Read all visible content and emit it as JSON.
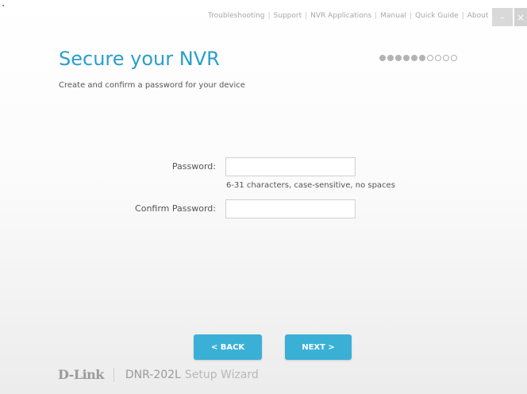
{
  "header": {
    "links": [
      "Troubleshooting",
      "Support",
      "NVR Applications",
      "Manual",
      "Quick Guide",
      "About"
    ],
    "minimize_label": "–",
    "close_label": "×"
  },
  "page": {
    "title": "Secure your NVR",
    "subtitle": "Create and confirm a password for your device"
  },
  "progress": {
    "total_steps": 10,
    "completed_steps": 6
  },
  "form": {
    "password_label": "Password:",
    "password_value": "",
    "password_hint": "6-31 characters, case-sensitive, no spaces",
    "confirm_label": "Confirm Password:",
    "confirm_value": ""
  },
  "buttons": {
    "back_label": "< BACK",
    "next_label": "NEXT >"
  },
  "footer": {
    "logo_text": "D-Link",
    "product_name": "DNR-202L",
    "wizard_name": "Setup Wizard"
  },
  "colors": {
    "accent": "#3ab0d6",
    "title": "#2a9fc9"
  }
}
